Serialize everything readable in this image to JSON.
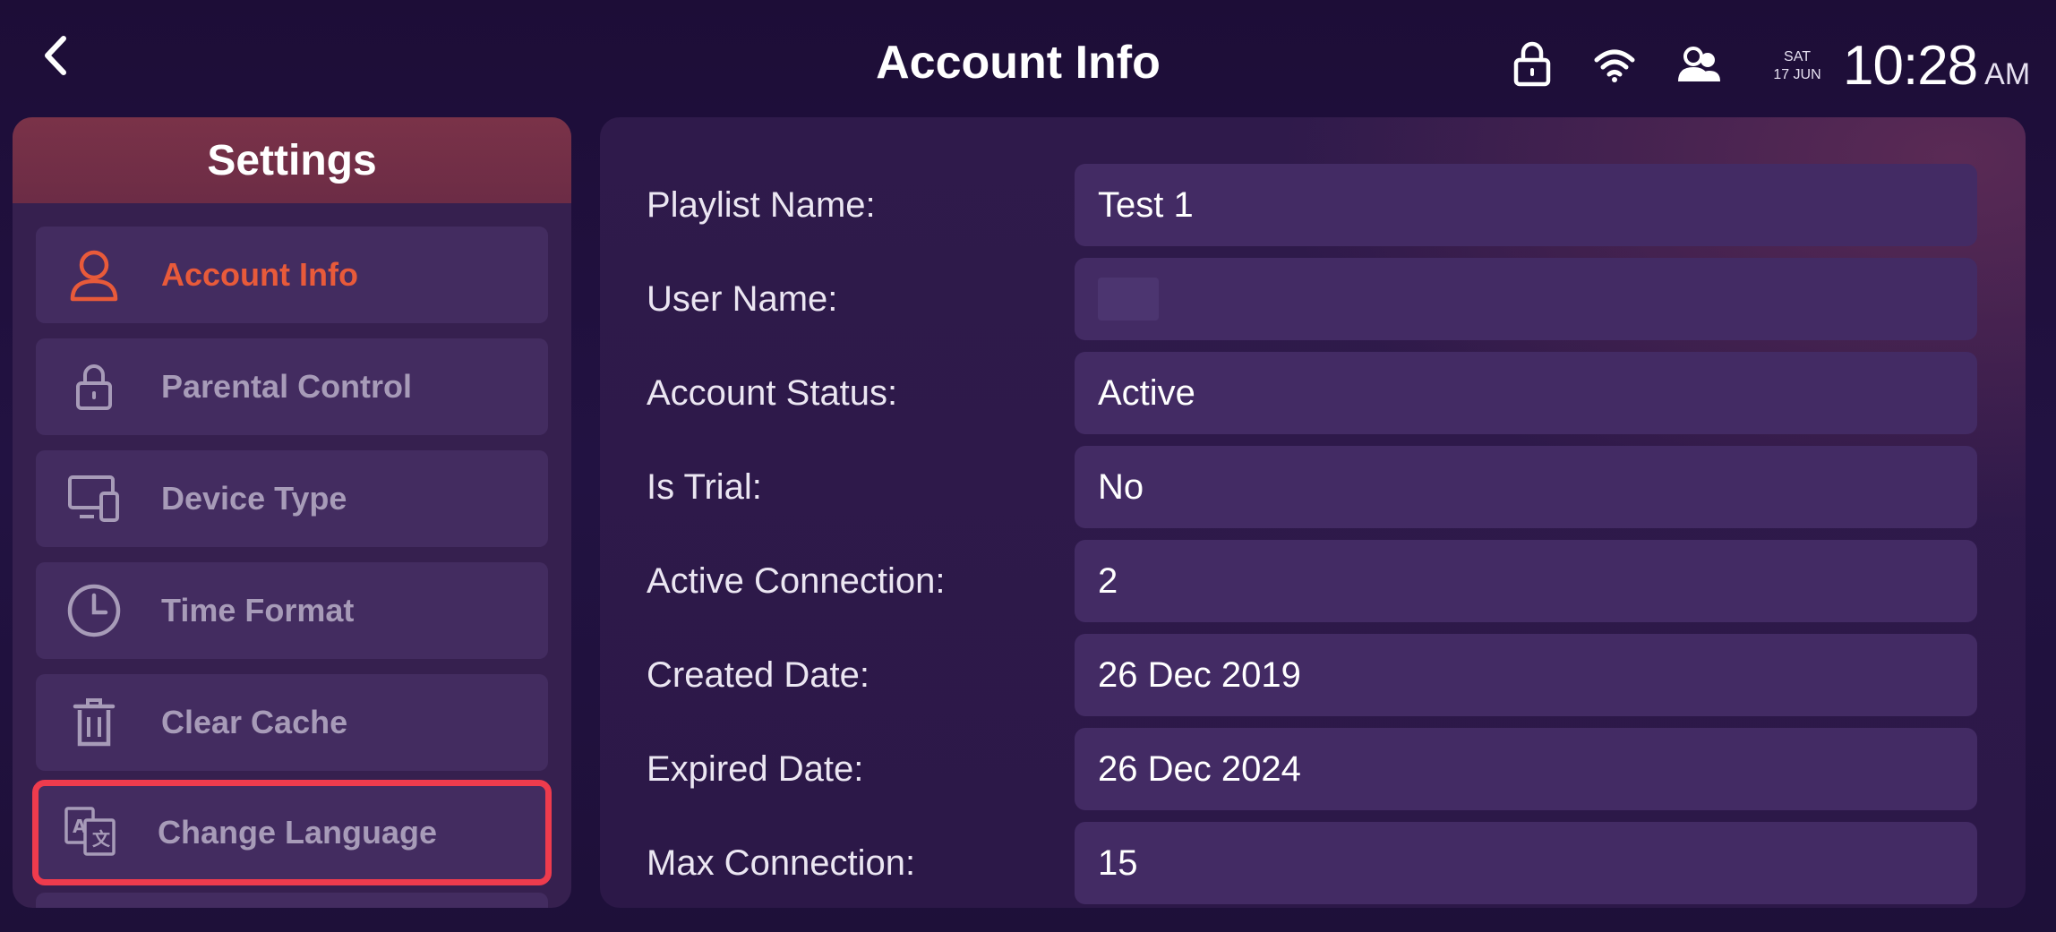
{
  "header": {
    "title": "Account Info",
    "date_day": "SAT",
    "date_num": "17 JUN",
    "time": "10:28",
    "ampm": "AM"
  },
  "icons": {
    "back": "chevron-left-icon",
    "lock": "lock-icon",
    "wifi": "wifi-icon",
    "users": "users-icon"
  },
  "sidebar": {
    "title": "Settings",
    "items": [
      {
        "label": "Account Info",
        "icon": "user-icon"
      },
      {
        "label": "Parental Control",
        "icon": "lock-icon"
      },
      {
        "label": "Device Type",
        "icon": "devices-icon"
      },
      {
        "label": "Time Format",
        "icon": "clock-icon"
      },
      {
        "label": "Clear Cache",
        "icon": "trash-icon"
      },
      {
        "label": "Change Language",
        "icon": "translate-icon"
      }
    ]
  },
  "account": {
    "rows": [
      {
        "label": "Playlist Name:",
        "value": "Test 1"
      },
      {
        "label": "User Name:",
        "value": ""
      },
      {
        "label": "Account Status:",
        "value": "Active"
      },
      {
        "label": "Is Trial:",
        "value": "No"
      },
      {
        "label": "Active Connection:",
        "value": "2"
      },
      {
        "label": "Created Date:",
        "value": "26 Dec 2019"
      },
      {
        "label": "Expired Date:",
        "value": "26 Dec 2024"
      },
      {
        "label": "Max Connection:",
        "value": "15"
      }
    ]
  },
  "colors": {
    "accent_active": "#e85a3a",
    "selection_border": "#ee3b4d",
    "sidebar_header": "#7a3248",
    "background": "#1d0d37"
  }
}
